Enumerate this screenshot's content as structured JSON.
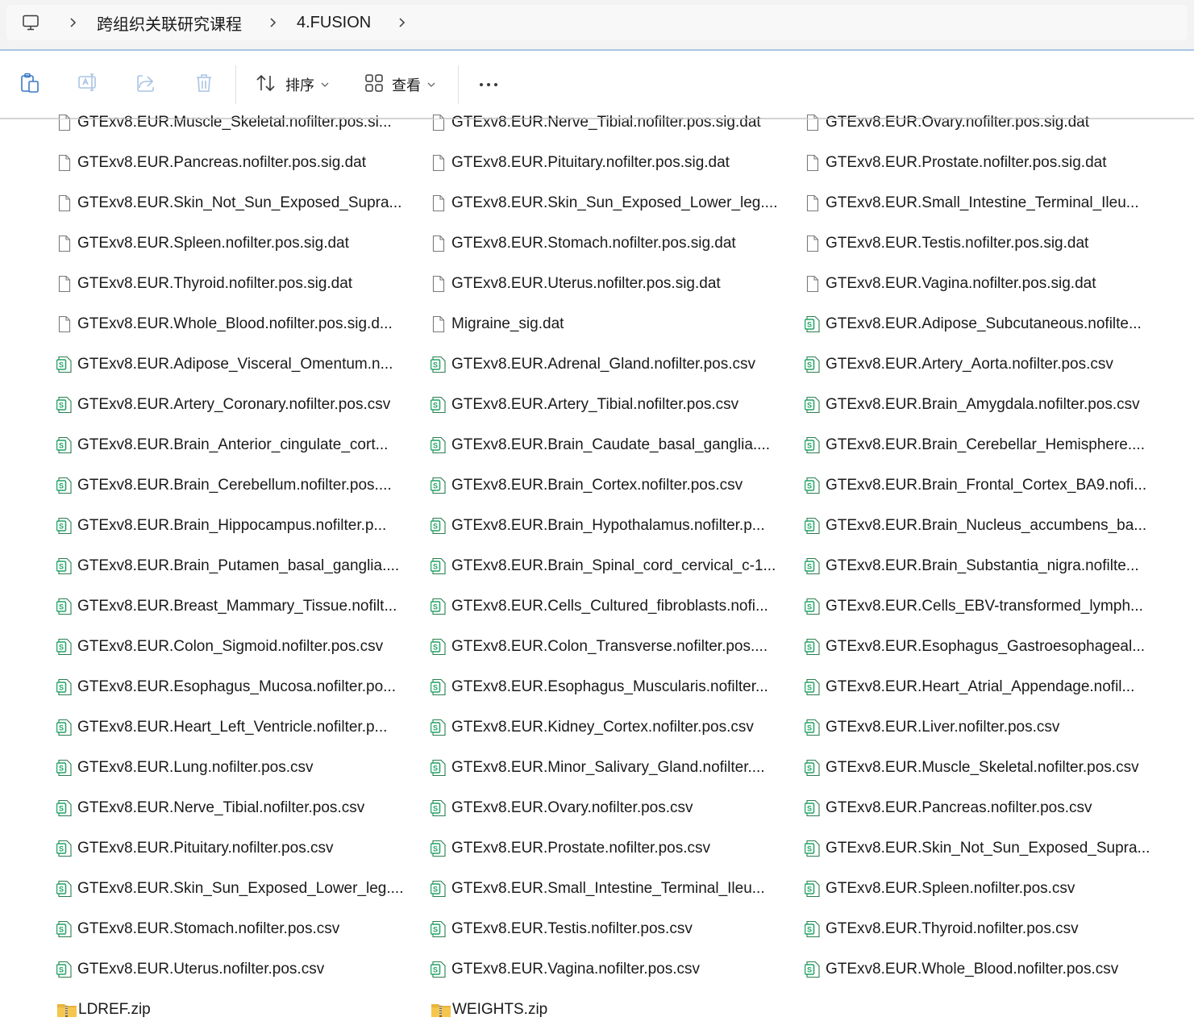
{
  "addressbar": {
    "crumbs": [
      "跨组织关联研究课程",
      "4.FUSION"
    ]
  },
  "toolbar": {
    "sort_label": "排序",
    "view_label": "查看"
  },
  "files": [
    [
      "GTExv8.EUR.Muscle_Skeletal.nofilter.pos.si...",
      "dat"
    ],
    [
      "GTExv8.EUR.Nerve_Tibial.nofilter.pos.sig.dat",
      "dat"
    ],
    [
      "GTExv8.EUR.Ovary.nofilter.pos.sig.dat",
      "dat"
    ],
    [
      "GTExv8.EUR.Pancreas.nofilter.pos.sig.dat",
      "dat"
    ],
    [
      "GTExv8.EUR.Pituitary.nofilter.pos.sig.dat",
      "dat"
    ],
    [
      "GTExv8.EUR.Prostate.nofilter.pos.sig.dat",
      "dat"
    ],
    [
      "GTExv8.EUR.Skin_Not_Sun_Exposed_Supra...",
      "dat"
    ],
    [
      "GTExv8.EUR.Skin_Sun_Exposed_Lower_leg....",
      "dat"
    ],
    [
      "GTExv8.EUR.Small_Intestine_Terminal_Ileu...",
      "dat"
    ],
    [
      "GTExv8.EUR.Spleen.nofilter.pos.sig.dat",
      "dat"
    ],
    [
      "GTExv8.EUR.Stomach.nofilter.pos.sig.dat",
      "dat"
    ],
    [
      "GTExv8.EUR.Testis.nofilter.pos.sig.dat",
      "dat"
    ],
    [
      "GTExv8.EUR.Thyroid.nofilter.pos.sig.dat",
      "dat"
    ],
    [
      "GTExv8.EUR.Uterus.nofilter.pos.sig.dat",
      "dat"
    ],
    [
      "GTExv8.EUR.Vagina.nofilter.pos.sig.dat",
      "dat"
    ],
    [
      "GTExv8.EUR.Whole_Blood.nofilter.pos.sig.d...",
      "dat"
    ],
    [
      "Migraine_sig.dat",
      "dat"
    ],
    [
      "GTExv8.EUR.Adipose_Subcutaneous.nofilte...",
      "csv"
    ],
    [
      "GTExv8.EUR.Adipose_Visceral_Omentum.n...",
      "csv"
    ],
    [
      "GTExv8.EUR.Adrenal_Gland.nofilter.pos.csv",
      "csv"
    ],
    [
      "GTExv8.EUR.Artery_Aorta.nofilter.pos.csv",
      "csv"
    ],
    [
      "GTExv8.EUR.Artery_Coronary.nofilter.pos.csv",
      "csv"
    ],
    [
      "GTExv8.EUR.Artery_Tibial.nofilter.pos.csv",
      "csv"
    ],
    [
      "GTExv8.EUR.Brain_Amygdala.nofilter.pos.csv",
      "csv"
    ],
    [
      "GTExv8.EUR.Brain_Anterior_cingulate_cort...",
      "csv"
    ],
    [
      "GTExv8.EUR.Brain_Caudate_basal_ganglia....",
      "csv"
    ],
    [
      "GTExv8.EUR.Brain_Cerebellar_Hemisphere....",
      "csv"
    ],
    [
      "GTExv8.EUR.Brain_Cerebellum.nofilter.pos....",
      "csv"
    ],
    [
      "GTExv8.EUR.Brain_Cortex.nofilter.pos.csv",
      "csv"
    ],
    [
      "GTExv8.EUR.Brain_Frontal_Cortex_BA9.nofi...",
      "csv"
    ],
    [
      "GTExv8.EUR.Brain_Hippocampus.nofilter.p...",
      "csv"
    ],
    [
      "GTExv8.EUR.Brain_Hypothalamus.nofilter.p...",
      "csv"
    ],
    [
      "GTExv8.EUR.Brain_Nucleus_accumbens_ba...",
      "csv"
    ],
    [
      "GTExv8.EUR.Brain_Putamen_basal_ganglia....",
      "csv"
    ],
    [
      "GTExv8.EUR.Brain_Spinal_cord_cervical_c-1...",
      "csv"
    ],
    [
      "GTExv8.EUR.Brain_Substantia_nigra.nofilte...",
      "csv"
    ],
    [
      "GTExv8.EUR.Breast_Mammary_Tissue.nofilt...",
      "csv"
    ],
    [
      "GTExv8.EUR.Cells_Cultured_fibroblasts.nofi...",
      "csv"
    ],
    [
      "GTExv8.EUR.Cells_EBV-transformed_lymph...",
      "csv"
    ],
    [
      "GTExv8.EUR.Colon_Sigmoid.nofilter.pos.csv",
      "csv"
    ],
    [
      "GTExv8.EUR.Colon_Transverse.nofilter.pos....",
      "csv"
    ],
    [
      "GTExv8.EUR.Esophagus_Gastroesophageal...",
      "csv"
    ],
    [
      "GTExv8.EUR.Esophagus_Mucosa.nofilter.po...",
      "csv"
    ],
    [
      "GTExv8.EUR.Esophagus_Muscularis.nofilter...",
      "csv"
    ],
    [
      "GTExv8.EUR.Heart_Atrial_Appendage.nofil...",
      "csv"
    ],
    [
      "GTExv8.EUR.Heart_Left_Ventricle.nofilter.p...",
      "csv"
    ],
    [
      "GTExv8.EUR.Kidney_Cortex.nofilter.pos.csv",
      "csv"
    ],
    [
      "GTExv8.EUR.Liver.nofilter.pos.csv",
      "csv"
    ],
    [
      "GTExv8.EUR.Lung.nofilter.pos.csv",
      "csv"
    ],
    [
      "GTExv8.EUR.Minor_Salivary_Gland.nofilter....",
      "csv"
    ],
    [
      "GTExv8.EUR.Muscle_Skeletal.nofilter.pos.csv",
      "csv"
    ],
    [
      "GTExv8.EUR.Nerve_Tibial.nofilter.pos.csv",
      "csv"
    ],
    [
      "GTExv8.EUR.Ovary.nofilter.pos.csv",
      "csv"
    ],
    [
      "GTExv8.EUR.Pancreas.nofilter.pos.csv",
      "csv"
    ],
    [
      "GTExv8.EUR.Pituitary.nofilter.pos.csv",
      "csv"
    ],
    [
      "GTExv8.EUR.Prostate.nofilter.pos.csv",
      "csv"
    ],
    [
      "GTExv8.EUR.Skin_Not_Sun_Exposed_Supra...",
      "csv"
    ],
    [
      "GTExv8.EUR.Skin_Sun_Exposed_Lower_leg....",
      "csv"
    ],
    [
      "GTExv8.EUR.Small_Intestine_Terminal_Ileu...",
      "csv"
    ],
    [
      "GTExv8.EUR.Spleen.nofilter.pos.csv",
      "csv"
    ],
    [
      "GTExv8.EUR.Stomach.nofilter.pos.csv",
      "csv"
    ],
    [
      "GTExv8.EUR.Testis.nofilter.pos.csv",
      "csv"
    ],
    [
      "GTExv8.EUR.Thyroid.nofilter.pos.csv",
      "csv"
    ],
    [
      "GTExv8.EUR.Uterus.nofilter.pos.csv",
      "csv"
    ],
    [
      "GTExv8.EUR.Vagina.nofilter.pos.csv",
      "csv"
    ],
    [
      "GTExv8.EUR.Whole_Blood.nofilter.pos.csv",
      "csv"
    ],
    [
      "LDREF.zip",
      "zip"
    ],
    [
      "WEIGHTS.zip",
      "zip"
    ]
  ],
  "icons": {
    "dat": "document-icon",
    "csv": "spreadsheet-icon",
    "zip": "zip-folder-icon"
  },
  "colors": {
    "csv_icon_green": "#21a366",
    "zip_folder_yellow": "#e8b43b"
  }
}
